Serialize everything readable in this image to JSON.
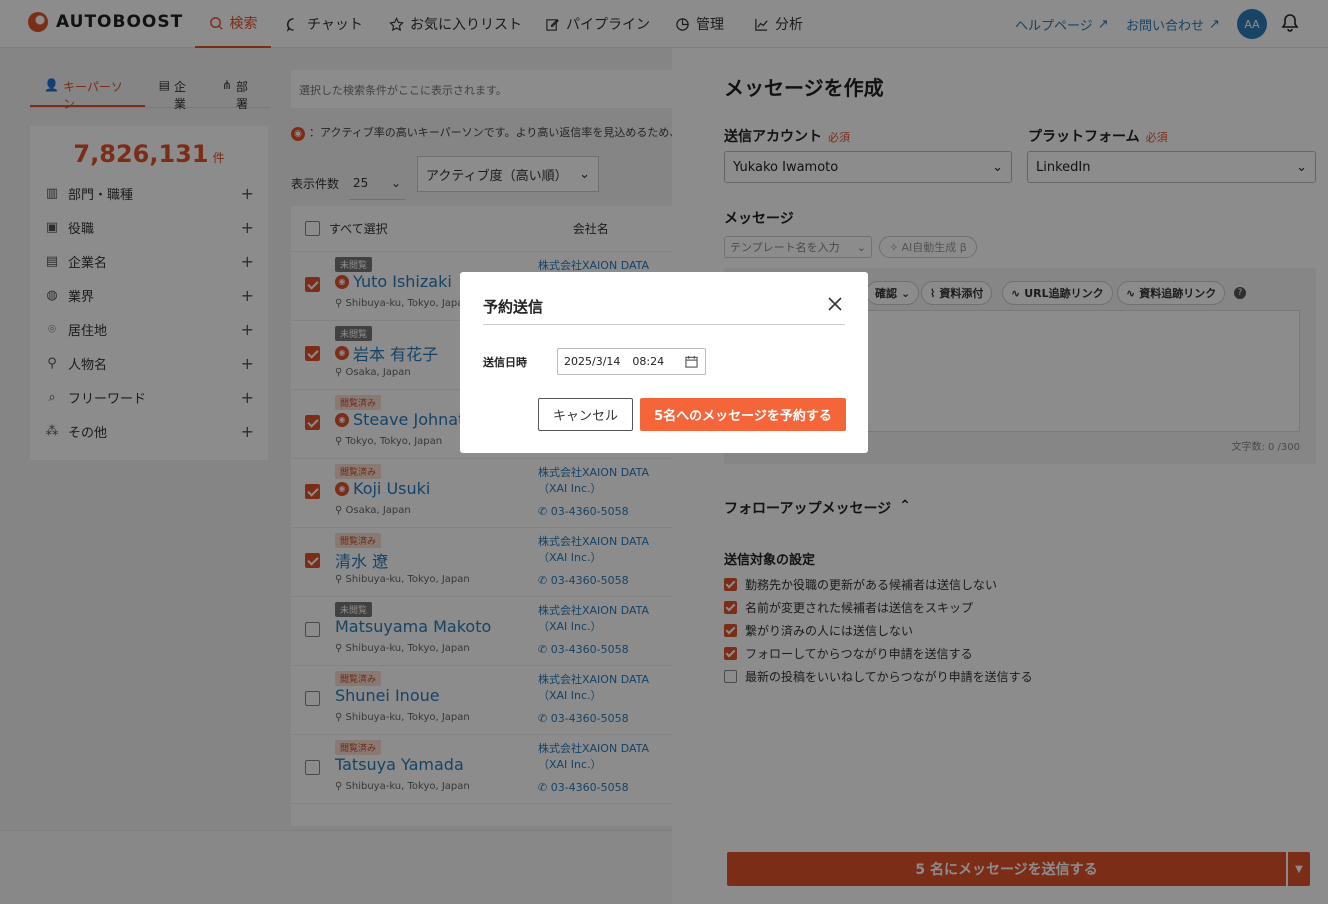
{
  "app": {
    "logo_text": "AUTOBOOST",
    "brand_color": "#e0532a"
  },
  "nav": {
    "items": [
      {
        "label": "検索",
        "icon": "search-icon",
        "active": true
      },
      {
        "label": "チャット",
        "icon": "chat-icon"
      },
      {
        "label": "お気に入りリスト",
        "icon": "star-icon"
      },
      {
        "label": "パイプライン",
        "icon": "edit-icon"
      },
      {
        "label": "管理",
        "icon": "pie-icon"
      },
      {
        "label": "分析",
        "icon": "chart-icon"
      }
    ],
    "help_link": "ヘルプページ",
    "contact_link": "お問い合わせ",
    "avatar": "AA"
  },
  "left": {
    "tabs": [
      "キーパーソン",
      "企業",
      "部署"
    ],
    "count": "7,826,131",
    "count_unit": "件",
    "filters": [
      "部門・職種",
      "役職",
      "企業名",
      "業界",
      "居住地",
      "人物名",
      "フリーワード",
      "その他"
    ]
  },
  "list": {
    "condition_placeholder": "選択した検索条件がここに表示されます。",
    "note": "：アクティブ率の高いキーパーソンです。より高い返信率を見込めるため、",
    "per_page_label": "表示件数",
    "per_page_value": "25",
    "sort_value": "アクティブ度（高い順）",
    "select_all": "すべて選択",
    "company_header": "会社名",
    "rows": [
      {
        "badge": "未閲覧",
        "name": "Yuto Ishizaki",
        "location": "Shibuya-ku, Tokyo, Japan",
        "company": "株式会社XAION DATA（XAI",
        "phone": "",
        "checked": true,
        "active": true
      },
      {
        "badge": "未閲覧",
        "name": "岩本 有花子",
        "location": "Osaka, Japan",
        "company": "",
        "phone": "",
        "checked": true,
        "active": true
      },
      {
        "badge": "閲覧済み",
        "name": "Steave Johnath",
        "location": "Tokyo, Tokyo, Japan",
        "company": "",
        "phone": "",
        "checked": true,
        "active": true
      },
      {
        "badge": "閲覧済み",
        "name": "Koji Usuki",
        "location": "Osaka, Japan",
        "company": "株式会社XAION DATA（XAI Inc.）",
        "phone": "03-4360-5058",
        "checked": true,
        "active": true
      },
      {
        "badge": "閲覧済み",
        "name": "清水 遼",
        "location": "Shibuya-ku, Tokyo, Japan",
        "company": "株式会社XAION DATA（XAI Inc.）",
        "phone": "03-4360-5058",
        "checked": true,
        "active": false
      },
      {
        "badge": "未閲覧",
        "name": "Matsuyama Makoto",
        "location": "Shibuya-ku, Tokyo, Japan",
        "company": "株式会社XAION DATA（XAI Inc.）",
        "phone": "03-4360-5058",
        "checked": false,
        "active": false
      },
      {
        "badge": "閲覧済み",
        "name": "Shunei Inoue",
        "location": "Shibuya-ku, Tokyo, Japan",
        "company": "株式会社XAION DATA（XAI Inc.）",
        "phone": "03-4360-5058",
        "checked": false,
        "active": false
      },
      {
        "badge": "閲覧済み",
        "name": "Tatsuya Yamada",
        "location": "Shibuya-ku, Tokyo, Japan",
        "company": "株式会社XAION DATA（XAI Inc.）",
        "phone": "03-4360-5058",
        "checked": false,
        "active": false
      }
    ]
  },
  "message": {
    "title": "メッセージを作成",
    "account_label": "送信アカウント",
    "required": "必須",
    "account_value": "Yukako Iwamoto",
    "platform_label": "プラットフォーム",
    "platform_value": "LinkedIn",
    "message_label": "メッセージ",
    "template_placeholder": "テンプレート名を入力",
    "ai_button": "AI自動生成 β",
    "toolbar": [
      "確認",
      "資料添付",
      "URL追跡リンク",
      "資料追跡リンク"
    ],
    "char_count": "文字数: 0 /300",
    "followup": "フォローアップメッセージ",
    "options_title": "送信対象の設定",
    "options": [
      {
        "label": "勤務先か役職の更新がある候補者は送信しない",
        "checked": true
      },
      {
        "label": "名前が変更された候補者は送信をスキップ",
        "checked": true
      },
      {
        "label": "繋がり済みの人には送信しない",
        "checked": true
      },
      {
        "label": "フォローしてからつながり申請を送信する",
        "checked": true
      },
      {
        "label": "最新の投稿をいいねしてからつながり申請を送信する",
        "checked": false
      }
    ],
    "send_button": "5 名にメッセージを送信する"
  },
  "modal": {
    "title": "予約送信",
    "datetime_label": "送信日時",
    "date": "2025/3/14",
    "time": "08:24",
    "cancel": "キャンセル",
    "confirm": "5名へのメッセージを予約する"
  }
}
